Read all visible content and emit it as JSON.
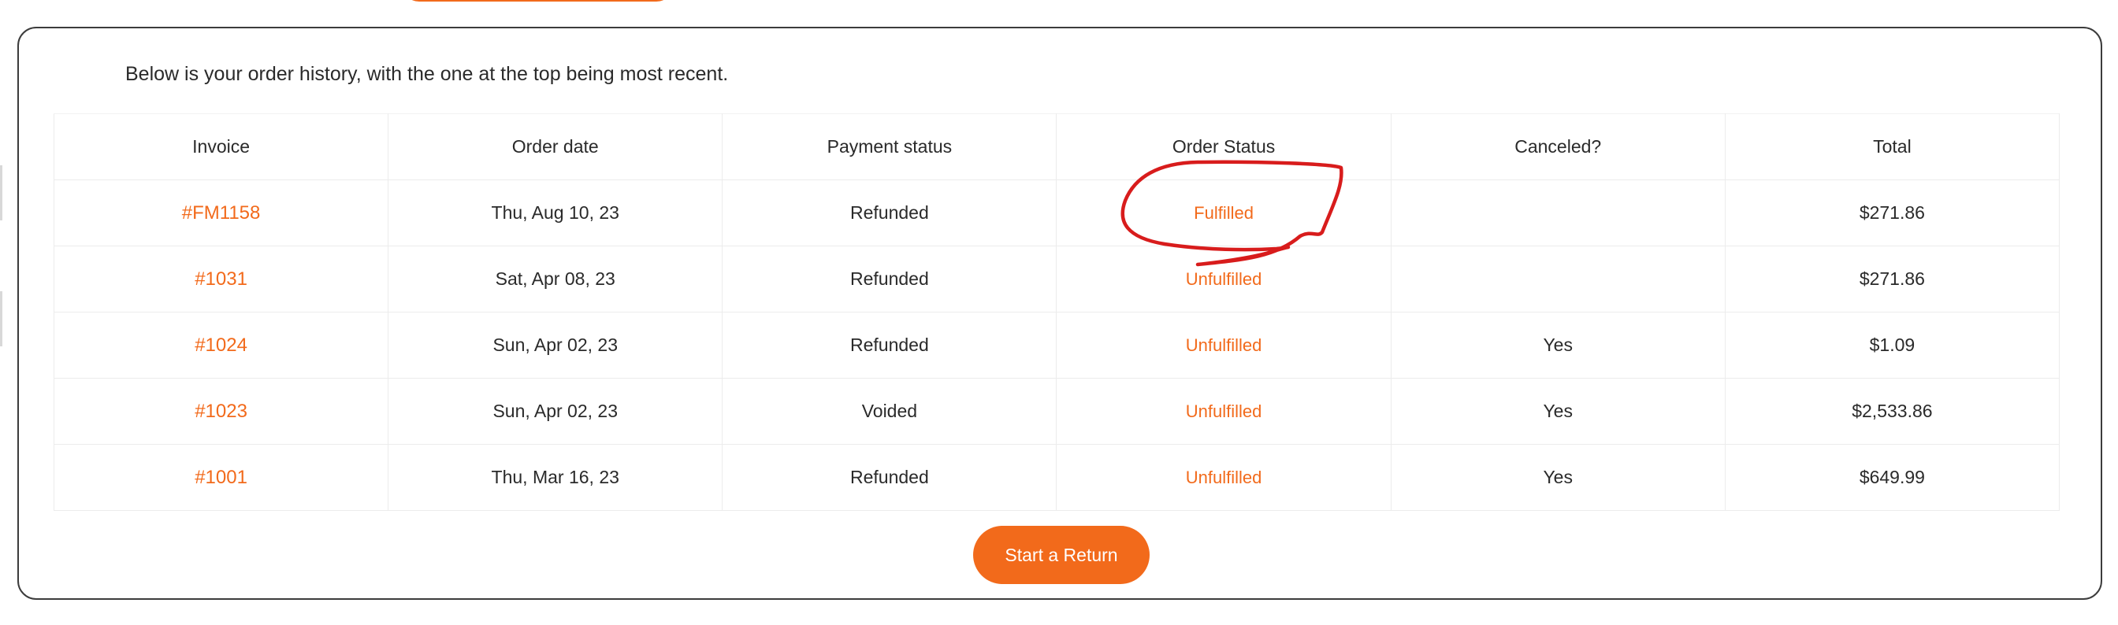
{
  "intro_text": "Below is your order history, with the one at the top being most recent.",
  "table": {
    "headers": {
      "invoice": "Invoice",
      "order_date": "Order date",
      "payment_status": "Payment status",
      "order_status": "Order Status",
      "canceled": "Canceled?",
      "total": "Total"
    },
    "rows": [
      {
        "invoice": "#FM1158",
        "order_date": "Thu, Aug 10, 23",
        "payment_status": "Refunded",
        "order_status": "Fulfilled",
        "canceled": "",
        "total": "$271.86"
      },
      {
        "invoice": "#1031",
        "order_date": "Sat, Apr 08, 23",
        "payment_status": "Refunded",
        "order_status": "Unfulfilled",
        "canceled": "",
        "total": "$271.86"
      },
      {
        "invoice": "#1024",
        "order_date": "Sun, Apr 02, 23",
        "payment_status": "Refunded",
        "order_status": "Unfulfilled",
        "canceled": "Yes",
        "total": "$1.09"
      },
      {
        "invoice": "#1023",
        "order_date": "Sun, Apr 02, 23",
        "payment_status": "Voided",
        "order_status": "Unfulfilled",
        "canceled": "Yes",
        "total": "$2,533.86"
      },
      {
        "invoice": "#1001",
        "order_date": "Thu, Mar 16, 23",
        "payment_status": "Refunded",
        "order_status": "Unfulfilled",
        "canceled": "Yes",
        "total": "$649.99"
      }
    ]
  },
  "start_return_label": "Start a Return",
  "colors": {
    "accent": "#f26a1b",
    "annotation": "#d81c1c",
    "border": "#3c3c3c"
  }
}
